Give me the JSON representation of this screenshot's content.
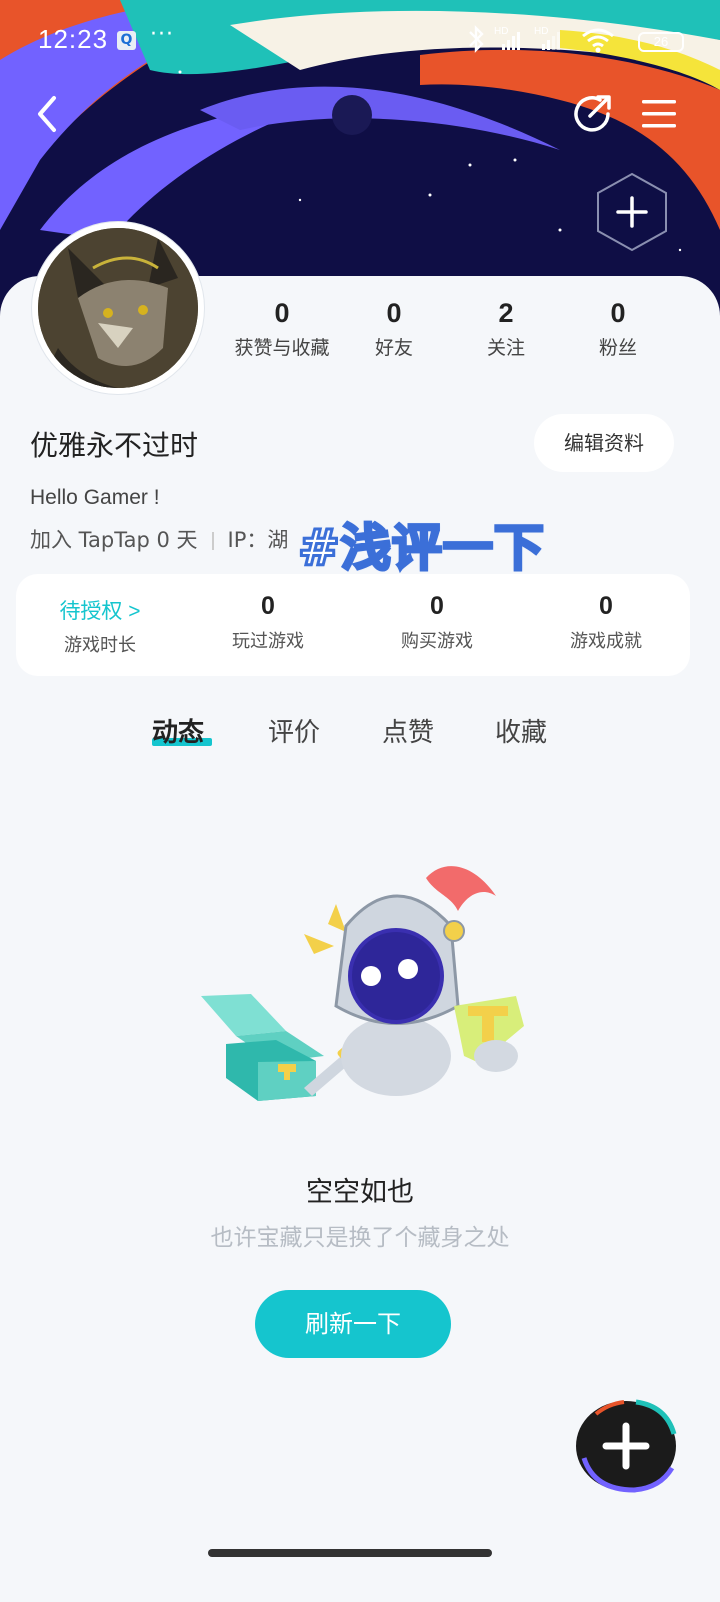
{
  "status_bar": {
    "time": "12:23",
    "notification_glyph": "Q",
    "more": "···",
    "signal_label_1": "HD",
    "signal_label_2": "HD",
    "battery": "26"
  },
  "header": {
    "back_icon": "chevron-left-icon",
    "share_icon": "share-icon",
    "menu_icon": "hamburger-menu-icon",
    "add_icon": "hexagon-plus-icon"
  },
  "profile": {
    "stats": [
      {
        "value": "0",
        "label": "获赞与收藏"
      },
      {
        "value": "0",
        "label": "好友"
      },
      {
        "value": "2",
        "label": "关注"
      },
      {
        "value": "0",
        "label": "粉丝"
      }
    ],
    "username": "优雅永不过时",
    "edit_label": "编辑资料",
    "bio": "Hello Gamer !",
    "joined": "加入 TapTap 0 天",
    "ip": "IP：湖"
  },
  "overlay": {
    "hashtag": "#浅评一下"
  },
  "game_stats": [
    {
      "value": "待授权 >",
      "label": "游戏时长"
    },
    {
      "value": "0",
      "label": "玩过游戏"
    },
    {
      "value": "0",
      "label": "购买游戏"
    },
    {
      "value": "0",
      "label": "游戏成就"
    }
  ],
  "tabs": [
    {
      "label": "动态",
      "active": true
    },
    {
      "label": "评价",
      "active": false
    },
    {
      "label": "点赞",
      "active": false
    },
    {
      "label": "收藏",
      "active": false
    }
  ],
  "empty_state": {
    "title": "空空如也",
    "subtitle": "也许宝藏只是换了个藏身之处",
    "refresh_label": "刷新一下"
  },
  "colors": {
    "accent": "#15c5ce",
    "banner_bg": "#0f0e45"
  }
}
